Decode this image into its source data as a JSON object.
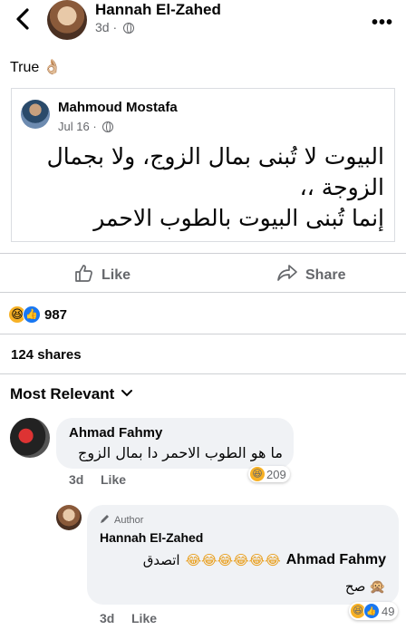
{
  "header": {
    "author": "Hannah El-Zahed",
    "time": "3d",
    "separator": "·"
  },
  "post": {
    "caption": "True",
    "caption_emoji": "👌🏼"
  },
  "shared_post": {
    "author": "Mahmoud Mostafa",
    "date": "Jul 16",
    "separator": "·",
    "line1": "البيوت لا تُبنى بمال الزوج، ولا بجمال",
    "line2": "الزوجة ،،",
    "line3": "إنما تُبنى البيوت بالطوب الاحمر"
  },
  "actions": {
    "like": "Like",
    "share": "Share"
  },
  "stats": {
    "reaction_count": "987",
    "shares": "124 shares"
  },
  "comments_filter": {
    "label": "Most Relevant"
  },
  "comment1": {
    "author": "Ahmad Fahmy",
    "text": "ما هو الطوب الاحمر دا بمال الزوج",
    "time": "3d",
    "like": "Like",
    "reactions": "209"
  },
  "reply1": {
    "badge": "Author",
    "author": "Hannah El-Zahed",
    "mention": "Ahmad Fahmy",
    "emojis": "😂😂😂😂😂😂",
    "text": "اتصدق",
    "line2": "صح",
    "line2_emoji": "🙊",
    "time": "3d",
    "like": "Like",
    "reactions": "49"
  },
  "colors": {
    "accent": "#1877f2",
    "muted": "#65676b",
    "bubble": "#f0f2f5"
  }
}
